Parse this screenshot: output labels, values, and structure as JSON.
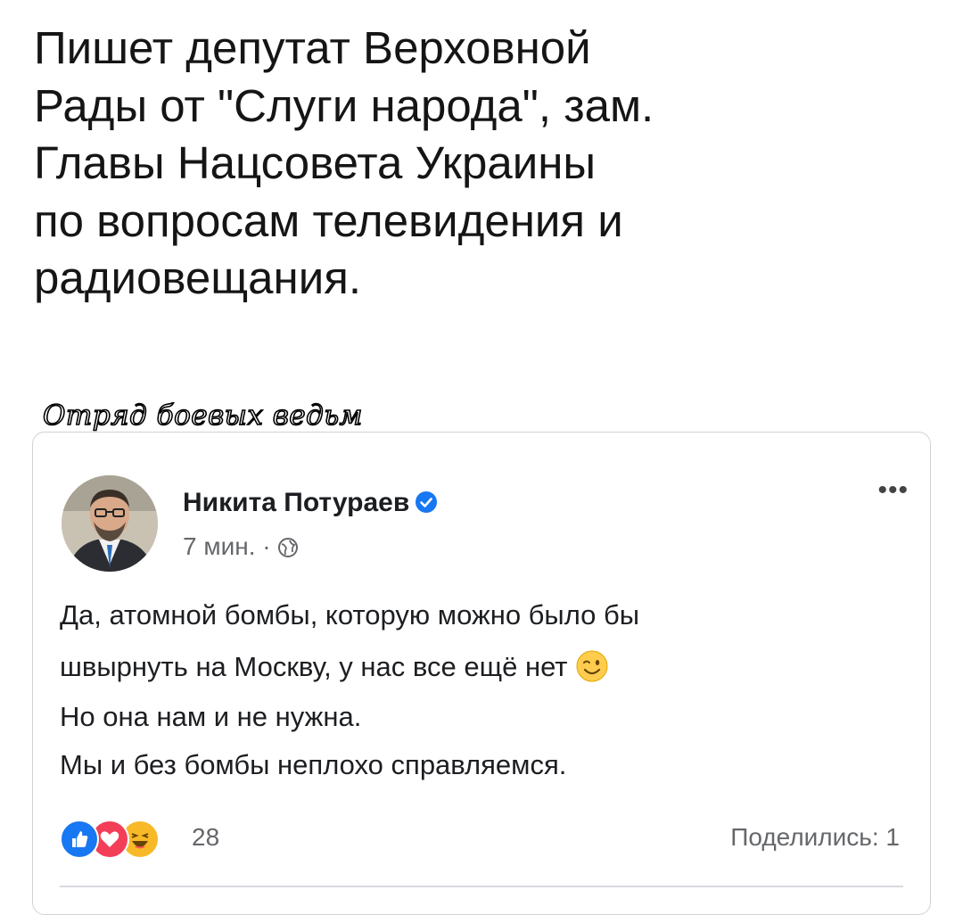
{
  "caption": {
    "text": "Пишет депутат Верховной\nРады от \"Слуги народа\", зам.\nГлавы Нацсовета Украины\nпо вопросам телевидения и\nрадиовещания."
  },
  "watermark": {
    "text": "Отряд боевых ведьм"
  },
  "post": {
    "author": "Никита Потураев",
    "verified_icon": "verified-badge-icon",
    "time": "7 мин.",
    "separator": "·",
    "privacy_icon": "globe-icon",
    "more_label": "•••",
    "lines": [
      "Да, атомной бомбы, которую можно было бы",
      "швырнуть на Москву, у нас все ещё нет",
      "Но она нам и не нужна.",
      "Мы и без бомбы неплохо справляемся."
    ],
    "emoji": "wink-emoji",
    "reaction_icons": [
      "like-icon",
      "love-icon",
      "haha-icon"
    ],
    "reaction_count": "28",
    "shares": "Поделились: 1"
  },
  "colors": {
    "accent": "#1877f2",
    "love": "#f33e58",
    "haha": "#f7b928",
    "muted": "#65676b"
  }
}
